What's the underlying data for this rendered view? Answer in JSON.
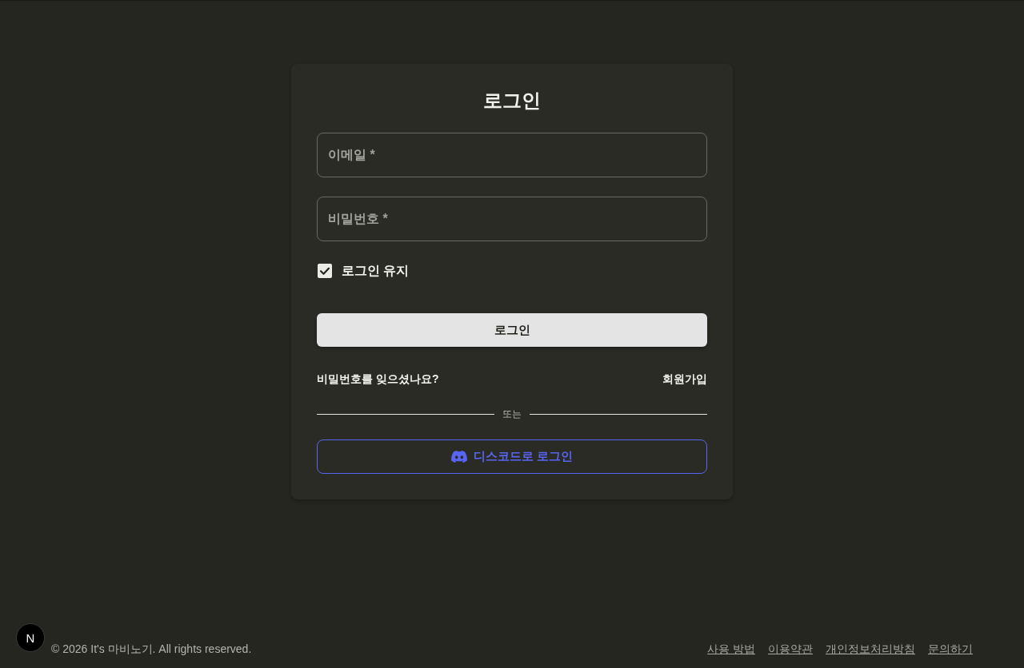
{
  "title": "로그인",
  "fields": [
    {
      "placeholder": "이메일 *"
    },
    {
      "placeholder": "비밀번호 *"
    }
  ],
  "remember": {
    "label": "로그인 유지",
    "checked": true
  },
  "submit": "로그인",
  "links": {
    "forgot": "비밀번호를 잊으셨나요?",
    "signup": "회원가입"
  },
  "divider": "또는",
  "discord_button": "디스코드로 로그인",
  "dev_badge": "N",
  "footer": {
    "copyright": "© 2026 It's 마비노기. All rights reserved.",
    "links": [
      "사용 방법",
      "이용약관",
      "개인정보처리방침",
      "문의하기"
    ]
  }
}
